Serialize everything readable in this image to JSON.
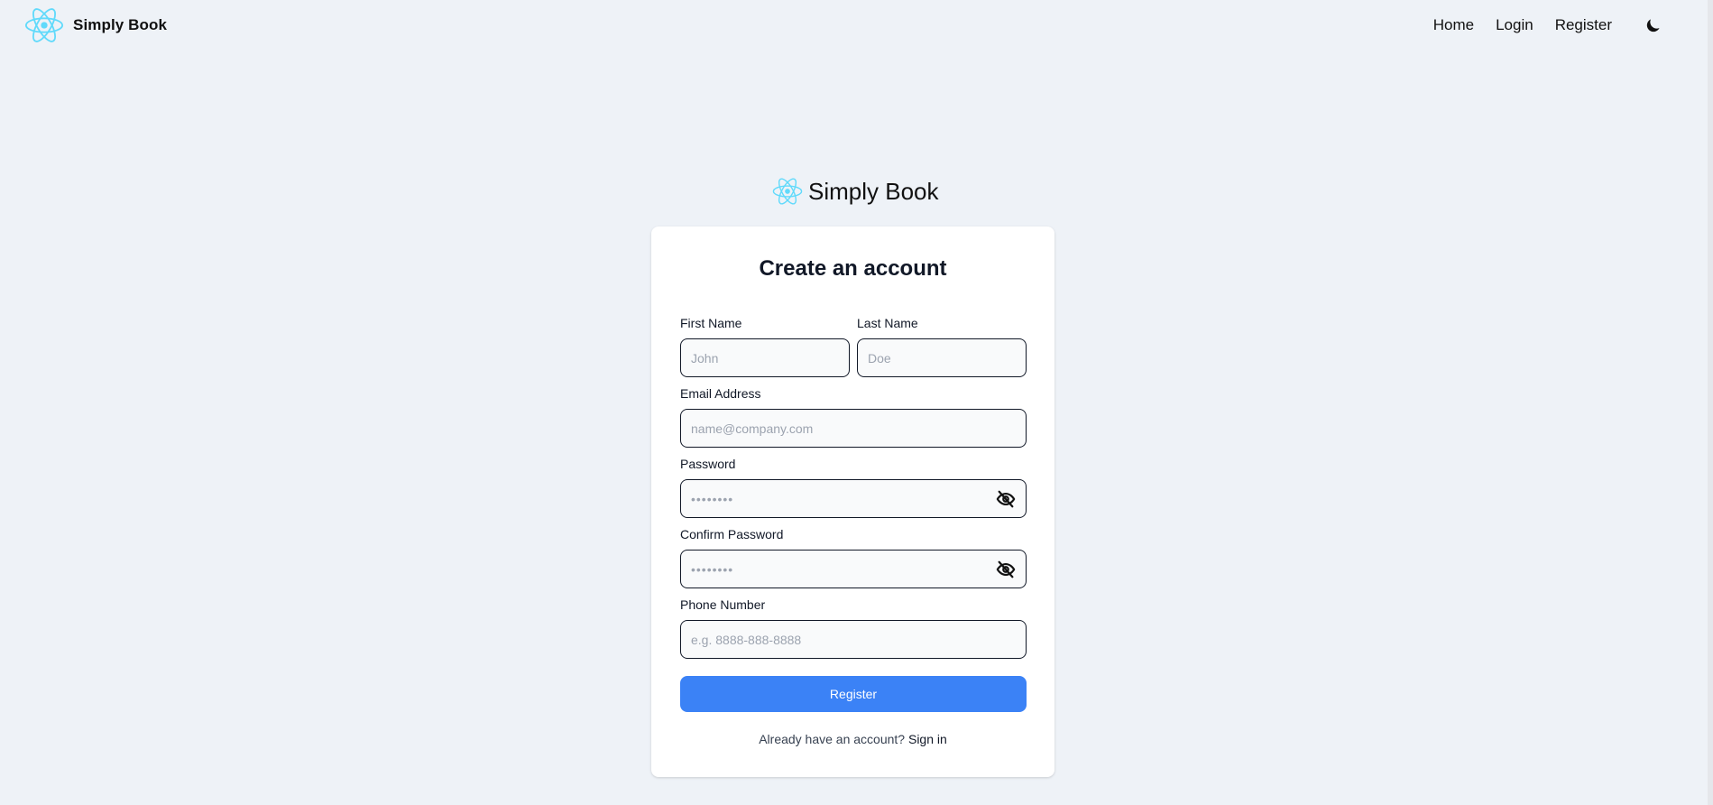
{
  "navbar": {
    "brand_name": "Simply Book",
    "brand_logo": "react-atom-icon",
    "links": [
      "Home",
      "Login",
      "Register"
    ],
    "theme_toggle_icon": "moon-icon"
  },
  "auth": {
    "brand_name": "Simply Book",
    "title": "Create an account",
    "first_name": {
      "label": "First Name",
      "placeholder": "John",
      "value": ""
    },
    "last_name": {
      "label": "Last Name",
      "placeholder": "Doe",
      "value": ""
    },
    "email": {
      "label": "Email Address",
      "placeholder": "name@company.com",
      "value": ""
    },
    "password": {
      "label": "Password",
      "placeholder": "••••••••",
      "value": "",
      "toggle_icon": "eye-off-icon"
    },
    "confirm_password": {
      "label": "Confirm Password",
      "placeholder": "••••••••",
      "value": "",
      "toggle_icon": "eye-off-icon"
    },
    "phone": {
      "label": "Phone Number",
      "placeholder": "e.g. 8888-888-8888",
      "value": ""
    },
    "submit_label": "Register",
    "footer_text": "Already have an account?",
    "footer_link": "Sign in"
  },
  "colors": {
    "page_background": "#eef2f7",
    "card_background": "#ffffff",
    "primary_button": "#3b82f6",
    "logo_accent": "#61dafb",
    "input_border": "#111827"
  }
}
